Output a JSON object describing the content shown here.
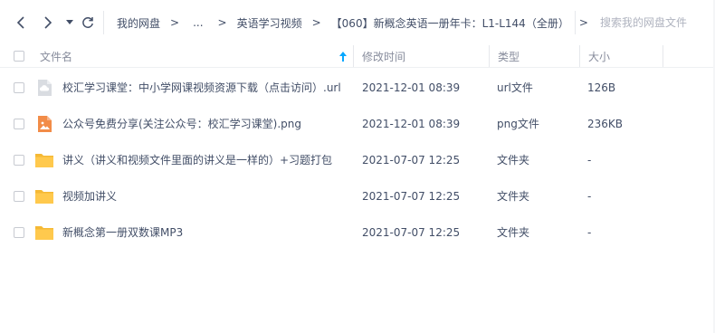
{
  "nav": {
    "back_icon": "chevron-left-icon",
    "forward_icon": "chevron-right-icon",
    "history_icon": "caret-down-icon",
    "refresh_icon": "refresh-icon"
  },
  "breadcrumb": {
    "items": [
      "我的网盘",
      "...",
      "英语学习视频",
      "【060】新概念英语一册年卡：L1-L144（全册）"
    ],
    "separator": ">",
    "trailing_separator": ">"
  },
  "search": {
    "placeholder": "搜索我的网盘文件"
  },
  "table": {
    "columns": {
      "name": "文件名",
      "modified": "修改时间",
      "type": "类型",
      "size": "大小"
    },
    "sort_icon": "sort-up-arrow-icon",
    "rows": [
      {
        "name": "校汇学习课堂：中小学网课视频资源下载（点击访问）.url",
        "modified": "2021-12-01 08:39",
        "type": "url文件",
        "size": "126B",
        "icon": "url-file-icon"
      },
      {
        "name": "公众号免费分享(关注公众号：校汇学习课堂).png",
        "modified": "2021-12-01 08:39",
        "type": "png文件",
        "size": "236KB",
        "icon": "image-file-icon"
      },
      {
        "name": "讲义（讲义和视频文件里面的讲义是一样的）+习题打包",
        "modified": "2021-07-07 12:25",
        "type": "文件夹",
        "size": "-",
        "icon": "folder-icon"
      },
      {
        "name": "视频加讲义",
        "modified": "2021-07-07 12:25",
        "type": "文件夹",
        "size": "-",
        "icon": "folder-icon"
      },
      {
        "name": "新概念第一册双数课MP3",
        "modified": "2021-07-07 12:25",
        "type": "文件夹",
        "size": "-",
        "icon": "folder-icon"
      }
    ]
  },
  "colors": {
    "text": "#424e67",
    "header_text": "#878c9c",
    "placeholder": "#afb3bf",
    "folder": "#ffc94d",
    "image_icon": "#f28c48",
    "url_icon": "#c9cdd4",
    "accent": "#06a7ff"
  }
}
